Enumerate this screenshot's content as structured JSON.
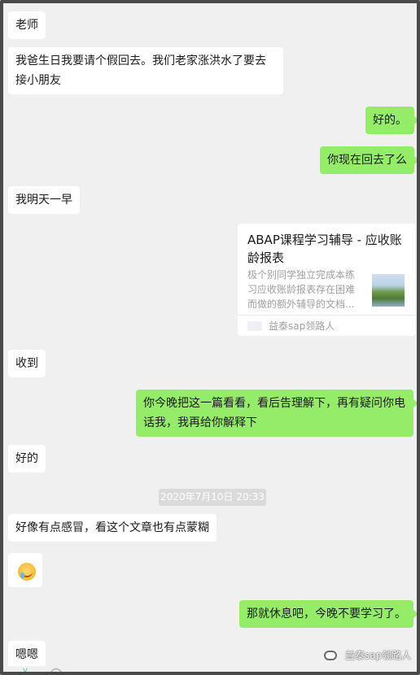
{
  "messages": [
    {
      "text": "老师"
    },
    {
      "text": "我爸生日我要请个假回去。我们老家涨洪水了要去接小朋友"
    },
    {
      "text": "好的。"
    },
    {
      "text": "你现在回去了么"
    },
    {
      "text": "我明天一早"
    },
    {
      "text": "收到"
    },
    {
      "text": "你今晚把这一篇看看，看后告理解下，再有疑问你电话我，我再给你解释下"
    },
    {
      "text": "好的"
    },
    {
      "text": "好像有点感冒，看这个文章也有点蒙糊"
    },
    {
      "text": "那就休息吧，今晚不要学习了。"
    },
    {
      "text": "嗯嗯"
    }
  ],
  "card": {
    "title": "ABAP课程学习辅导 - 应收账龄报表",
    "description": "极个别同学独立完成本练习应收账龄报表存在困难而做的额外辅导的文档...",
    "source": "益泰sap领路人"
  },
  "timestamp": "2020年7月10日 20:33",
  "watermark": "益泰sap领路人",
  "icons": {
    "emoji": "crying-laughing-emoji-icon",
    "watermark": "wechat-icon",
    "voice": "voice-icon",
    "sticker": "emoji-face-icon"
  },
  "colors": {
    "incoming": "#ffffff",
    "outgoing": "#95ec69",
    "background": "#f0f0f0"
  }
}
